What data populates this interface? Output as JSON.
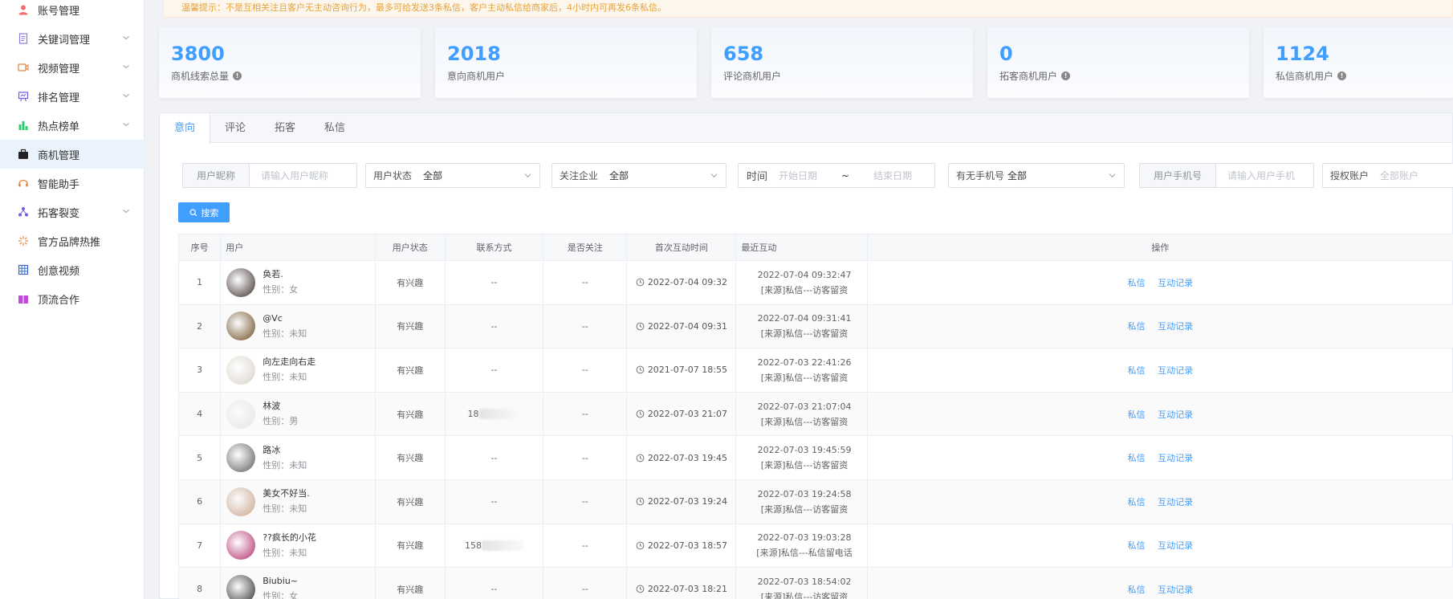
{
  "sidebar": {
    "items": [
      {
        "label": "账号管理",
        "icon": "user-icon",
        "color": "#f56c6c",
        "has_chevron": false
      },
      {
        "label": "关键词管理",
        "icon": "document-icon",
        "color": "#8c7ae6",
        "has_chevron": true
      },
      {
        "label": "视频管理",
        "icon": "video-icon",
        "color": "#e6803c",
        "has_chevron": true
      },
      {
        "label": "排名管理",
        "icon": "presentation-icon",
        "color": "#6c5ce7",
        "has_chevron": true
      },
      {
        "label": "热点榜单",
        "icon": "bar-chart-icon",
        "color": "#2ecc71",
        "has_chevron": true
      },
      {
        "label": "商机管理",
        "icon": "briefcase-icon",
        "color": "#222222",
        "has_chevron": false,
        "active": true
      },
      {
        "label": "智能助手",
        "icon": "headset-icon",
        "color": "#e6803c",
        "has_chevron": false
      },
      {
        "label": "拓客裂变",
        "icon": "fission-icon",
        "color": "#6c5ce7",
        "has_chevron": true
      },
      {
        "label": "官方品牌热推",
        "icon": "sparkle-icon",
        "color": "#e6803c",
        "has_chevron": false
      },
      {
        "label": "创意视频",
        "icon": "grid-icon",
        "color": "#3d6bd6",
        "has_chevron": false
      },
      {
        "label": "顶流合作",
        "icon": "gift-icon",
        "color": "#c04bd8",
        "has_chevron": false
      }
    ]
  },
  "notice": "温馨提示：不是互相关注且客户无主动咨询行为，最多可给发送3条私信，客户主动私信给商家后，4小时内可再发6条私信。",
  "stats": [
    {
      "value": "3800",
      "label": "商机线索总量",
      "info": true
    },
    {
      "value": "2018",
      "label": "意向商机用户",
      "info": false
    },
    {
      "value": "658",
      "label": "评论商机用户",
      "info": false
    },
    {
      "value": "0",
      "label": "拓客商机用户",
      "info": true
    },
    {
      "value": "1124",
      "label": "私信商机用户",
      "info": true
    }
  ],
  "tabs": [
    "意向",
    "评论",
    "拓客",
    "私信"
  ],
  "filters": {
    "nickname_label": "用户昵称",
    "nickname_placeholder": "请输入用户昵称",
    "status_label": "用户状态",
    "status_value": "全部",
    "company_label": "关注企业",
    "company_value": "全部",
    "time_label": "时间",
    "time_start_placeholder": "开始日期",
    "time_sep": "~",
    "time_end_placeholder": "结束日期",
    "phone_has_label": "有无手机号",
    "phone_has_value": "全部",
    "phone_label": "用户手机号",
    "phone_placeholder": "请输入用户手机",
    "account_label": "授权账户",
    "account_placeholder": "全部账户"
  },
  "search_button": "搜索",
  "table": {
    "headers": [
      "序号",
      "用户",
      "用户状态",
      "联系方式",
      "是否关注",
      "首次互动时间",
      "最近互动",
      "操作"
    ],
    "actions": [
      "私信",
      "互动记录"
    ],
    "rows": [
      {
        "no": "1",
        "name": "奂若.",
        "gender": "性别：女",
        "status": "有兴趣",
        "contact": "--",
        "contact_blurred": false,
        "follow": "--",
        "first_time": "2022-07-04 09:32",
        "recent_time": "2022-07-04 09:32:47",
        "recent_src": "[来源]私信---访客留资",
        "avatar_color": "#3a2a2a"
      },
      {
        "no": "2",
        "name": "@Vc",
        "gender": "性别：未知",
        "status": "有兴趣",
        "contact": "--",
        "contact_blurred": false,
        "follow": "--",
        "first_time": "2022-07-04 09:31",
        "recent_time": "2022-07-04 09:31:41",
        "recent_src": "[来源]私信---访客留资",
        "avatar_color": "#6b4a1e"
      },
      {
        "no": "3",
        "name": "向左走向右走",
        "gender": "性别：未知",
        "status": "有兴趣",
        "contact": "--",
        "contact_blurred": false,
        "follow": "--",
        "first_time": "2021-07-07 18:55",
        "recent_time": "2022-07-03 22:41:26",
        "recent_src": "[来源]私信---访客留资",
        "avatar_color": "#d8d2c8"
      },
      {
        "no": "4",
        "name": "林波",
        "gender": "性别：男",
        "status": "有兴趣",
        "contact": "18",
        "contact_blurred": true,
        "follow": "--",
        "first_time": "2022-07-03 21:07",
        "recent_time": "2022-07-03 21:07:04",
        "recent_src": "[来源]私信---访客留资",
        "avatar_color": "#e4e4e4"
      },
      {
        "no": "5",
        "name": "路冰",
        "gender": "性别：未知",
        "status": "有兴趣",
        "contact": "--",
        "contact_blurred": false,
        "follow": "--",
        "first_time": "2022-07-03 19:45",
        "recent_time": "2022-07-03 19:45:59",
        "recent_src": "[来源]私信---访客留资",
        "avatar_color": "#5a5a5a"
      },
      {
        "no": "6",
        "name": "美女不好当.",
        "gender": "性别：未知",
        "status": "有兴趣",
        "contact": "--",
        "contact_blurred": false,
        "follow": "--",
        "first_time": "2022-07-03 19:24",
        "recent_time": "2022-07-03 19:24:58",
        "recent_src": "[来源]私信---访客留资",
        "avatar_color": "#c9a58c"
      },
      {
        "no": "7",
        "name": "??疯长的小花",
        "gender": "性别：未知",
        "status": "有兴趣",
        "contact": "158",
        "contact_blurred": true,
        "follow": "--",
        "first_time": "2022-07-03 18:57",
        "recent_time": "2022-07-03 19:03:28",
        "recent_src": "[来源]私信---私信留电话",
        "avatar_color": "#b0286a"
      },
      {
        "no": "8",
        "name": "Biubiu~",
        "gender": "性别：女",
        "status": "有兴趣",
        "contact": "--",
        "contact_blurred": false,
        "follow": "--",
        "first_time": "2022-07-03 18:21",
        "recent_time": "2022-07-03 18:54:02",
        "recent_src": "[来源]私信---访客留资",
        "avatar_color": "#2a2a2a"
      }
    ]
  },
  "colors": {
    "primary": "#409eff",
    "notice_text": "#e6a23c",
    "notice_bg": "#fdf6ec"
  }
}
